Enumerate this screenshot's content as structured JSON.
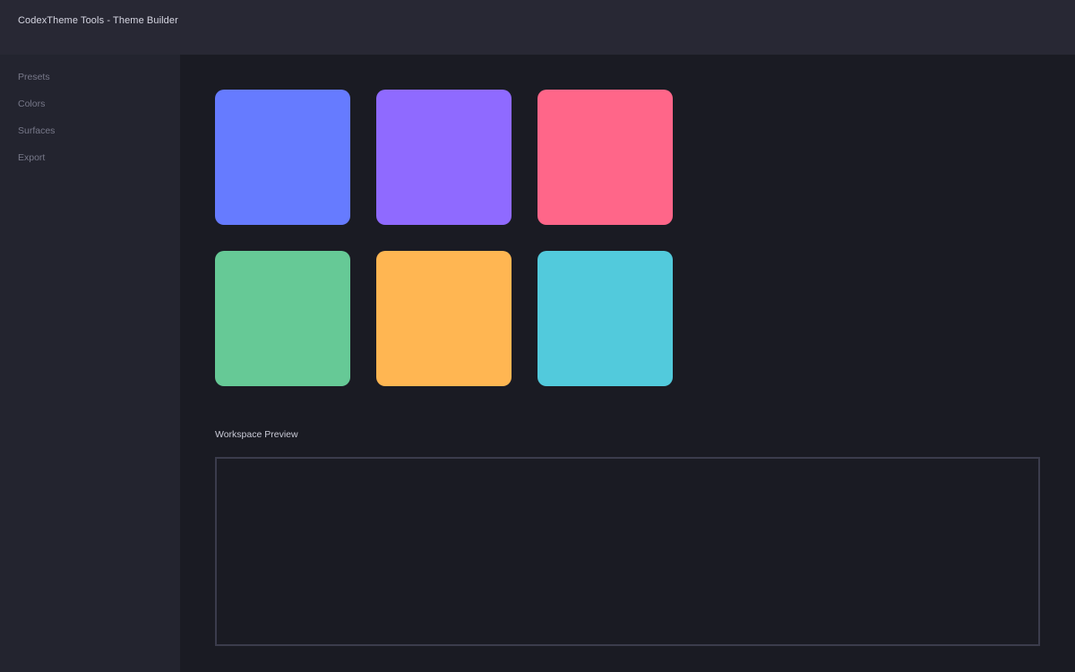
{
  "window": {
    "title": "CodexTheme Tools - Theme Builder"
  },
  "sidebar": {
    "items": [
      {
        "label": "Presets"
      },
      {
        "label": "Colors"
      },
      {
        "label": "Surfaces"
      },
      {
        "label": "Export"
      }
    ]
  },
  "swatches": [
    {
      "color": "#667bff"
    },
    {
      "color": "#8f6aff"
    },
    {
      "color": "#ff6689"
    },
    {
      "color": "#66c996"
    },
    {
      "color": "#ffb652"
    },
    {
      "color": "#52cadc"
    }
  ],
  "preview": {
    "label": "Workspace Preview"
  }
}
